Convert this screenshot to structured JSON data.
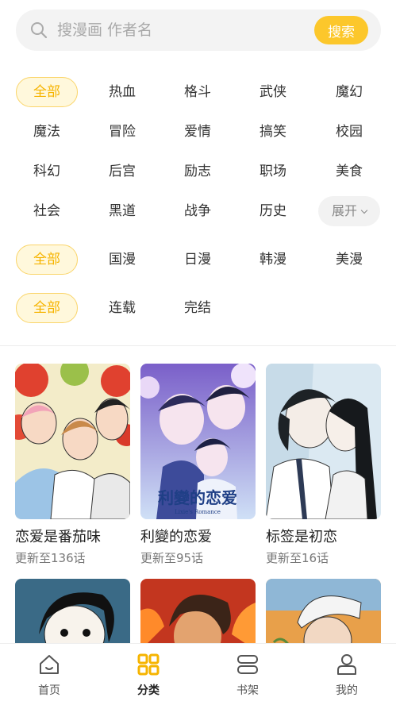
{
  "search": {
    "placeholder": "搜漫画 作者名",
    "button_label": "搜索"
  },
  "filters": {
    "genre_row1": [
      "全部",
      "热血",
      "格斗",
      "武侠",
      "魔幻"
    ],
    "genre_row2": [
      "魔法",
      "冒险",
      "爱情",
      "搞笑",
      "校园"
    ],
    "genre_row3": [
      "科幻",
      "后宫",
      "励志",
      "职场",
      "美食"
    ],
    "genre_row4": [
      "社会",
      "黑道",
      "战争",
      "历史"
    ],
    "expand_label": "展开",
    "region": [
      "全部",
      "国漫",
      "日漫",
      "韩漫",
      "美漫"
    ],
    "status": [
      "全部",
      "连载",
      "完结"
    ]
  },
  "comics": [
    {
      "title": "恋爱是番茄味",
      "update": "更新至136话"
    },
    {
      "title": "利變的恋爱",
      "update": "更新至95话",
      "cover_text": "利變的恋爱",
      "cover_subtext": "Lixie's Romance"
    },
    {
      "title": "标签是初恋",
      "update": "更新至16话"
    }
  ],
  "nav": [
    {
      "label": "首页",
      "icon": "home-icon"
    },
    {
      "label": "分类",
      "icon": "category-icon"
    },
    {
      "label": "书架",
      "icon": "bookshelf-icon"
    },
    {
      "label": "我的",
      "icon": "profile-icon"
    }
  ],
  "colors": {
    "accent": "#fcc72b",
    "active_text": "#f6b400"
  }
}
